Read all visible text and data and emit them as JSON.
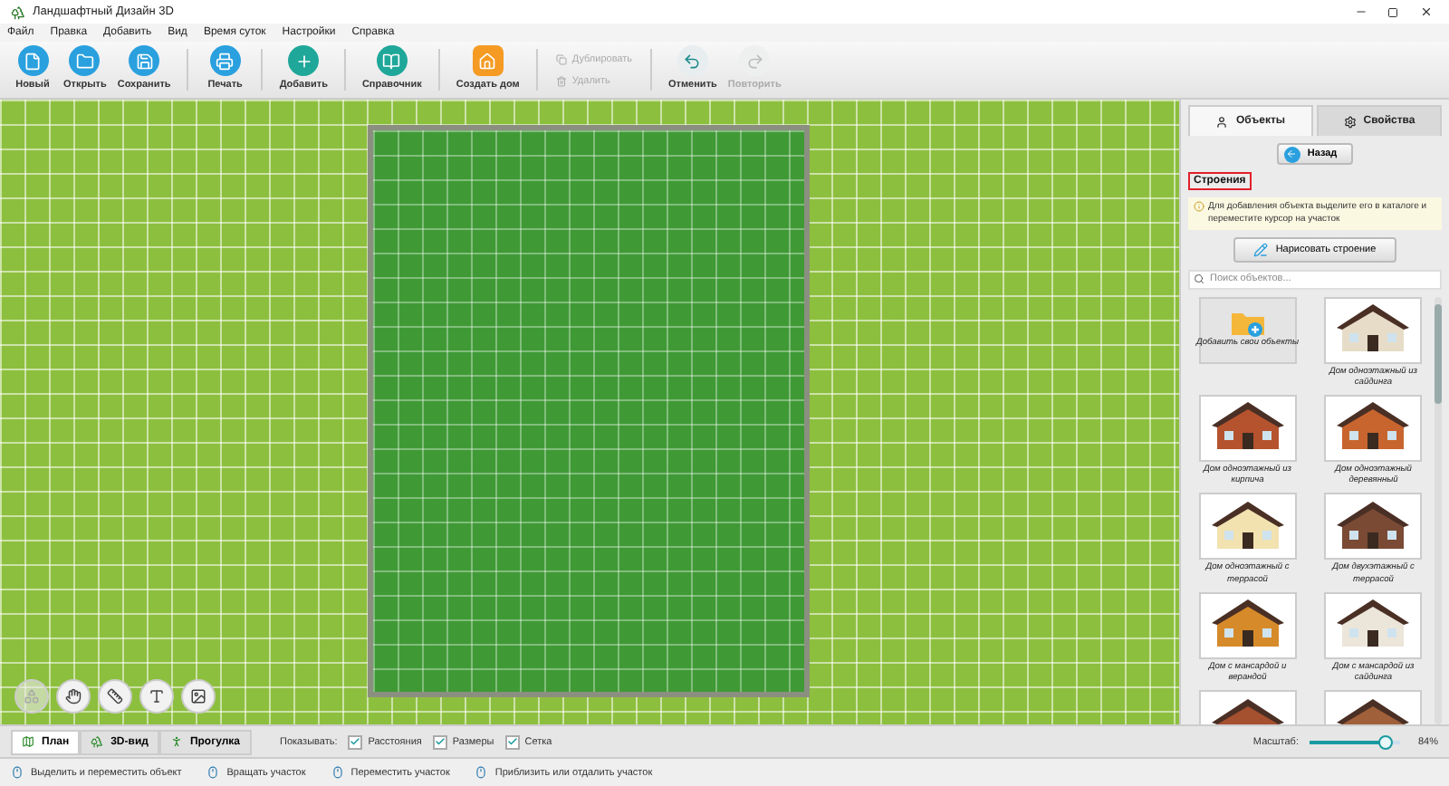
{
  "window": {
    "title": "Ландшафтный Дизайн 3D"
  },
  "menu": [
    "Файл",
    "Правка",
    "Добавить",
    "Вид",
    "Время суток",
    "Настройки",
    "Справка"
  ],
  "toolbar": [
    {
      "kind": "big",
      "label": "Новый",
      "disabled": false
    },
    {
      "kind": "big",
      "label": "Открыть",
      "disabled": false
    },
    {
      "kind": "big",
      "label": "Сохранить",
      "disabled": false
    },
    {
      "kind": "sep"
    },
    {
      "kind": "big",
      "label": "Печать",
      "disabled": false
    },
    {
      "kind": "sep"
    },
    {
      "kind": "big",
      "label": "Добавить",
      "disabled": false
    },
    {
      "kind": "sep"
    },
    {
      "kind": "big",
      "label": "Справочник",
      "disabled": false
    },
    {
      "kind": "sep"
    },
    {
      "kind": "big",
      "label": "Создать дом",
      "disabled": false
    },
    {
      "kind": "sep"
    },
    {
      "kind": "pair",
      "items": [
        {
          "label": "Дублировать",
          "disabled": true
        },
        {
          "label": "Удалить",
          "disabled": true
        }
      ]
    },
    {
      "kind": "sep"
    },
    {
      "kind": "big",
      "label": "Отменить",
      "disabled": false
    },
    {
      "kind": "big",
      "label": "Повторить",
      "disabled": true
    }
  ],
  "canvas_tools": [
    {
      "disabled": true
    },
    {
      "disabled": false
    },
    {
      "disabled": false
    },
    {
      "disabled": false
    },
    {
      "disabled": false
    }
  ],
  "panel": {
    "tabs": [
      {
        "label": "Объекты",
        "selected": true
      },
      {
        "label": "Свойства",
        "selected": false
      }
    ],
    "back": "Назад",
    "section": "Строения",
    "hint": "Для добавления объекта выделите его в каталоге и переместите курсор на участок",
    "draw_button": "Нарисовать строение",
    "search": {
      "placeholder": "Поиск объектов..."
    },
    "items": [
      {
        "kind": "add",
        "name": "Добавить свои объекты"
      },
      {
        "kind": "house",
        "name": "Дом одноэтажный из сайдинга",
        "color": "#e6dcc8"
      },
      {
        "kind": "house",
        "name": "Дом одноэтажный из кирпича",
        "color": "#b5532e"
      },
      {
        "kind": "house",
        "name": "Дом одноэтажный деревянный",
        "color": "#c8652f"
      },
      {
        "kind": "house",
        "name": "Дом одноэтажный с террасой",
        "color": "#f2e2b0"
      },
      {
        "kind": "house",
        "name": "Дом двухэтажный с террасой",
        "color": "#7a4a35"
      },
      {
        "kind": "house",
        "name": "Дом с мансардой и верандой",
        "color": "#d68a2a"
      },
      {
        "kind": "house",
        "name": "Дом с мансардой из сайдинга",
        "color": "#ece6da"
      },
      {
        "kind": "house",
        "color": "#a5502f"
      },
      {
        "kind": "house",
        "color": "#a0603a"
      }
    ]
  },
  "views": [
    {
      "label": "План",
      "selected": true
    },
    {
      "label": "3D-вид",
      "selected": false
    },
    {
      "label": "Прогулка",
      "selected": false
    }
  ],
  "show_label": "Показывать:",
  "show": [
    {
      "label": "Расстояния",
      "checked": true
    },
    {
      "label": "Размеры",
      "checked": true
    },
    {
      "label": "Сетка",
      "checked": true
    }
  ],
  "zoom": {
    "label": "Масштаб:",
    "level": 0.84,
    "reading": "84%"
  },
  "status": [
    "Выделить и переместить объект",
    "Вращать участок",
    "Переместить участок",
    "Приблизить или отдалить участок"
  ]
}
